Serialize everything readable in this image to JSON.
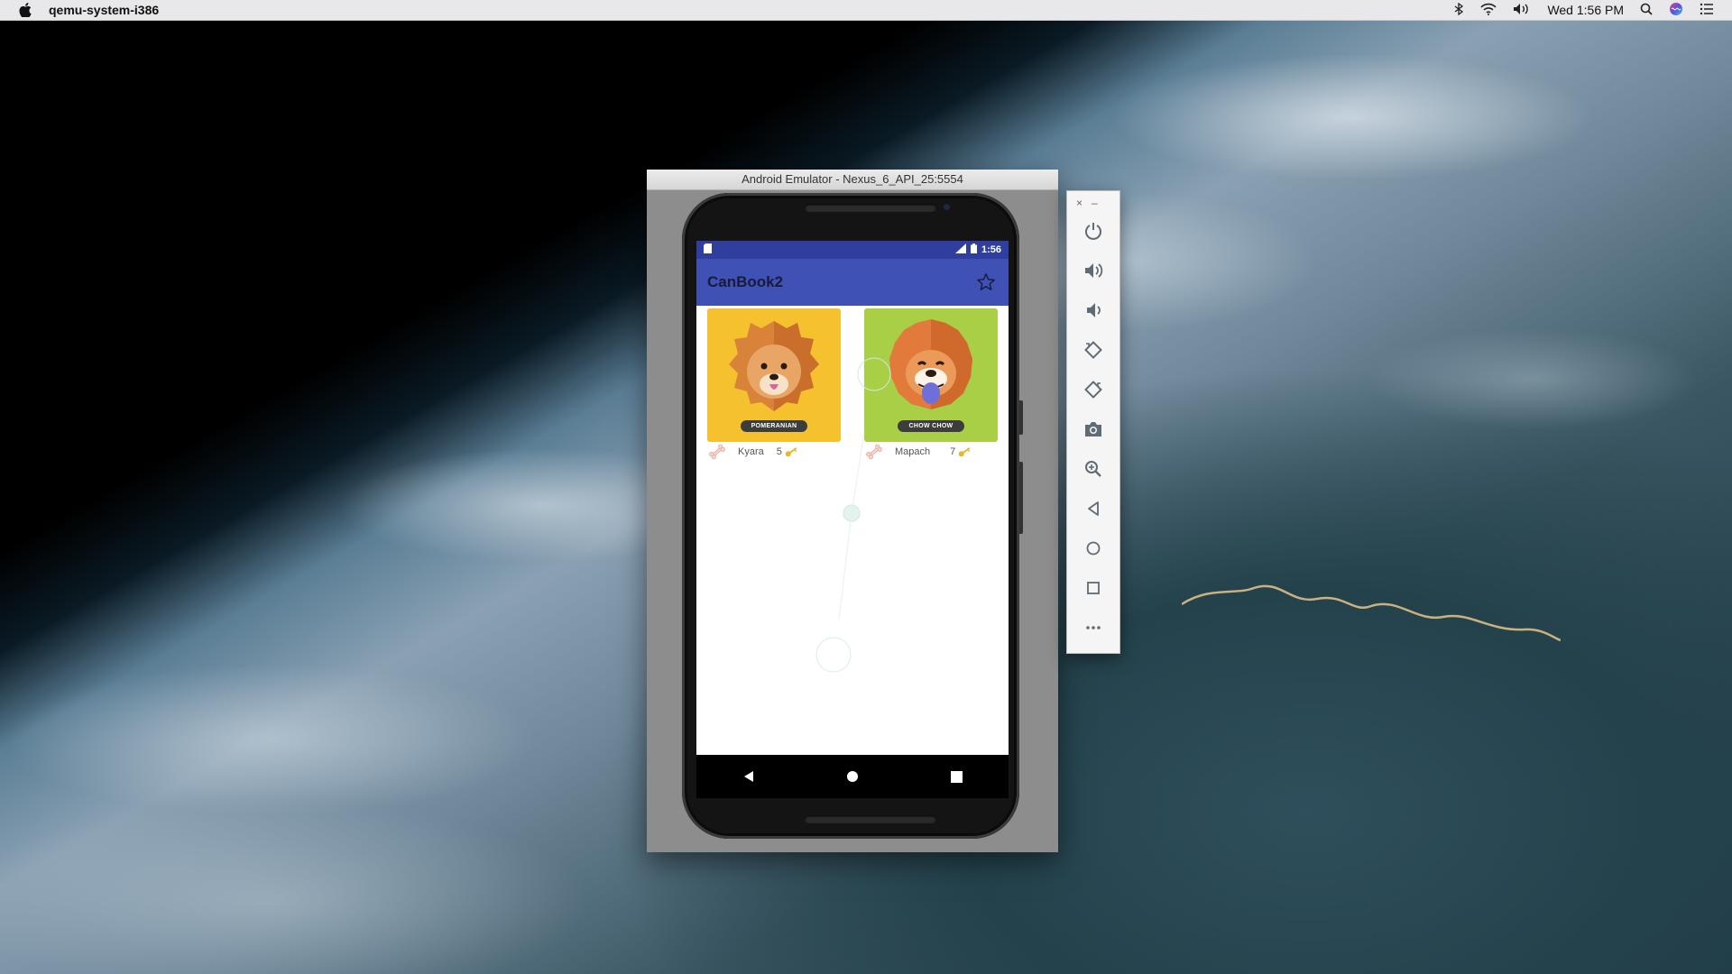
{
  "menubar": {
    "app_name": "qemu-system-i386",
    "clock": "Wed 1:56 PM",
    "icons": [
      "apple-icon",
      "bluetooth-icon",
      "wifi-icon",
      "volume-icon",
      "spotlight-search-icon",
      "siri-icon",
      "notification-center-icon"
    ]
  },
  "emulator_window": {
    "title": "Android Emulator - Nexus_6_API_25:5554"
  },
  "device": {
    "status_time": "1:56",
    "app_title": "CanBook2",
    "cards": [
      {
        "breed": "POMERANIAN",
        "name": "Kyara",
        "count": "5",
        "bg_color": "#f5c12e"
      },
      {
        "breed": "CHOW CHOW",
        "name": "Mapach",
        "count": "7",
        "bg_color": "#a9cf46"
      }
    ],
    "nav": [
      "back-icon",
      "home-icon",
      "recents-icon"
    ]
  },
  "toolbar": {
    "window_controls": [
      "close-icon",
      "minimize-icon"
    ],
    "buttons": [
      "power-icon",
      "volume-up-icon",
      "volume-down-icon",
      "rotate-left-icon",
      "rotate-right-icon",
      "screenshot-camera-icon",
      "zoom-icon",
      "back-icon",
      "home-icon",
      "overview-icon",
      "more-icon"
    ],
    "close_glyph": "×",
    "minimize_glyph": "–"
  },
  "colors": {
    "primary": "#3f51b5",
    "primary_dark": "#303f9f"
  }
}
